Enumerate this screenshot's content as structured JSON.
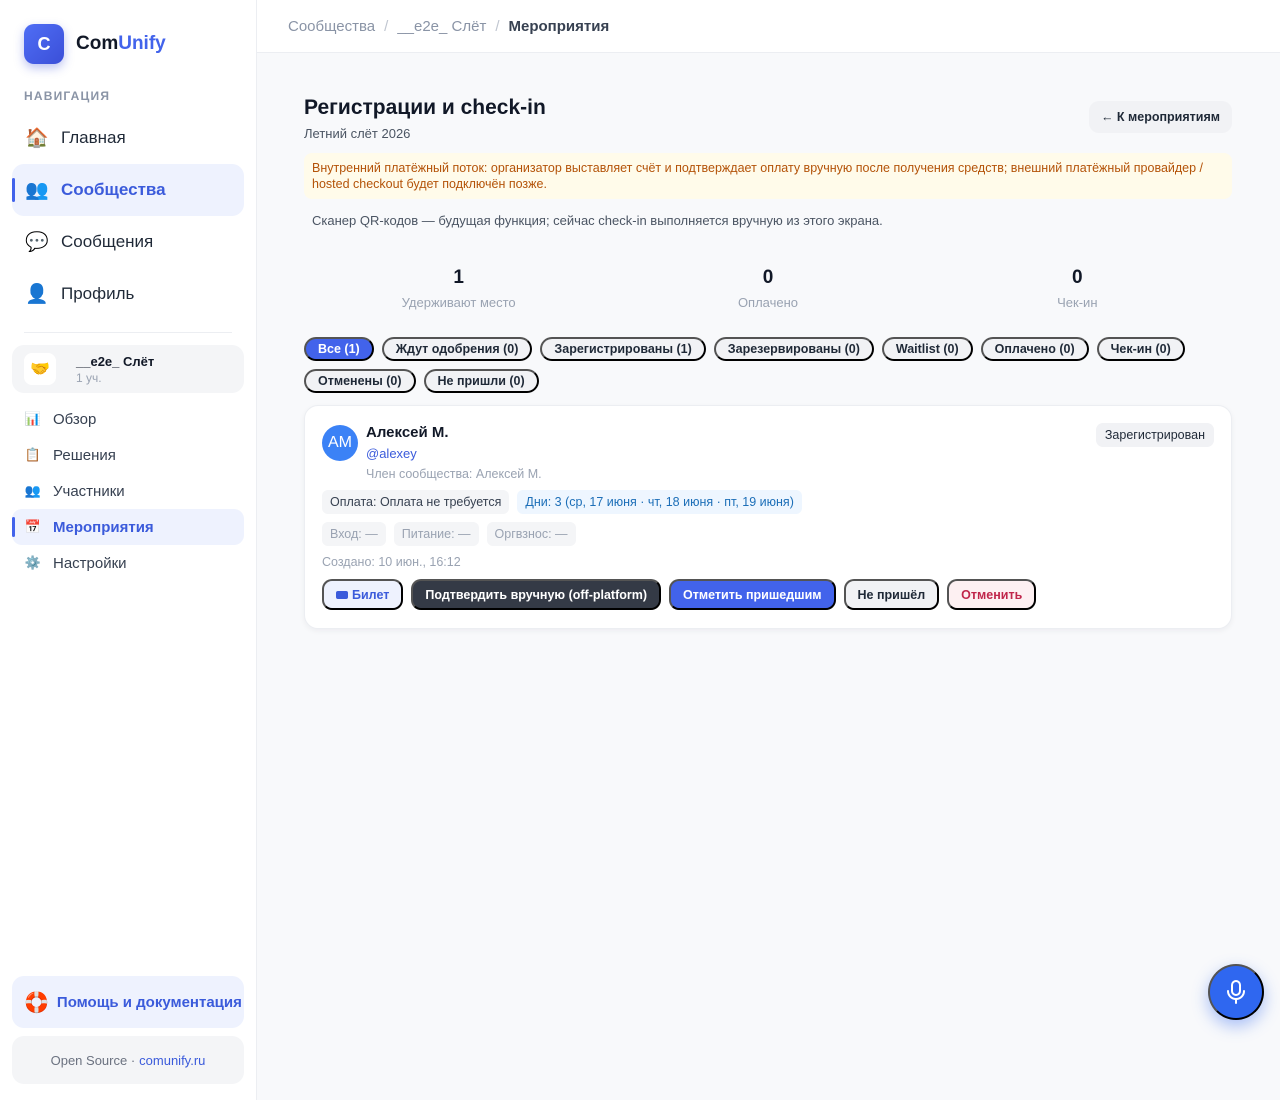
{
  "brand": {
    "logo_letter": "C",
    "name_part1": "Com",
    "name_part2": "Unify",
    "accent_color": "#4263eb"
  },
  "sidebar": {
    "nav_label": "НАВИГАЦИЯ",
    "items": [
      {
        "label": "Главная",
        "icon": "🏠",
        "icon_name": "home-icon",
        "active": false
      },
      {
        "label": "Сообщества",
        "icon": "👥",
        "icon_name": "users-icon",
        "active": true
      },
      {
        "label": "Сообщения",
        "icon": "💬",
        "icon_name": "chat-icon",
        "active": false
      },
      {
        "label": "Профиль",
        "icon": "👤",
        "icon_name": "user-icon",
        "active": false
      }
    ],
    "community": {
      "icon": "🤝",
      "name": "__e2e_ Слёт",
      "members": "1 уч."
    },
    "sub_items": [
      {
        "label": "Обзор",
        "icon": "📊",
        "icon_name": "chart-icon",
        "active": false
      },
      {
        "label": "Решения",
        "icon": "📋",
        "icon_name": "clipboard-icon",
        "active": false
      },
      {
        "label": "Участники",
        "icon": "👥",
        "icon_name": "members-icon",
        "active": false
      },
      {
        "label": "Мероприятия",
        "icon": "📅",
        "icon_name": "calendar-icon",
        "active": true
      },
      {
        "label": "Настройки",
        "icon": "⚙️",
        "icon_name": "gear-icon",
        "active": false
      }
    ],
    "help": {
      "icon": "🛟",
      "label": "Помощь и документация"
    },
    "footer": {
      "text": "Open Source ·",
      "link": "comunify.ru"
    }
  },
  "breadcrumb": {
    "items": [
      "Сообщества",
      "__e2e_ Слёт"
    ],
    "separator": "/",
    "current": "Мероприятия"
  },
  "page": {
    "title": "Регистрации и check-in",
    "subtitle": "Летний слёт 2026",
    "back_label": "← К мероприятиям",
    "notice": "Внутренний платёжный поток: организатор выставляет счёт и подтверждает оплату вручную после получения средств; внешний платёжный провайдер / hosted checkout будет подключён позже.",
    "qr_note": "Сканер QR-кодов — будущая функция; сейчас check-in выполняется вручную из этого экрана."
  },
  "stats": [
    {
      "value": "1",
      "label": "Удерживают место"
    },
    {
      "value": "0",
      "label": "Оплачено"
    },
    {
      "value": "0",
      "label": "Чек-ин"
    }
  ],
  "filters": [
    {
      "label": "Все (1)",
      "active": true
    },
    {
      "label": "Ждут одобрения (0)",
      "active": false
    },
    {
      "label": "Зарегистрированы (1)",
      "active": false
    },
    {
      "label": "Зарезервированы (0)",
      "active": false
    },
    {
      "label": "Waitlist (0)",
      "active": false
    },
    {
      "label": "Оплачено (0)",
      "active": false
    },
    {
      "label": "Чек-ин (0)",
      "active": false
    },
    {
      "label": "Отменены (0)",
      "active": false
    },
    {
      "label": "Не пришли (0)",
      "active": false
    }
  ],
  "registration": {
    "avatar_initials": "АМ",
    "name": "Алексей М.",
    "handle": "@alexey",
    "member": "Член сообщества: Алексей М.",
    "status": "Зарегистрирован",
    "payment": "Оплата: Оплата не требуется",
    "days": "Дни: 3 (ср, 17 июня · чт, 18 июня · пт, 19 июня)",
    "entry": "Вход: —",
    "food": "Питание: —",
    "fee": "Оргвзнос: —",
    "created": "Создано: 10 июн., 16:12",
    "actions": {
      "ticket": "Билет",
      "confirm": "Подтвердить вручную (off-platform)",
      "checkin": "Отметить пришедшим",
      "no_show": "Не пришёл",
      "cancel": "Отменить"
    }
  }
}
